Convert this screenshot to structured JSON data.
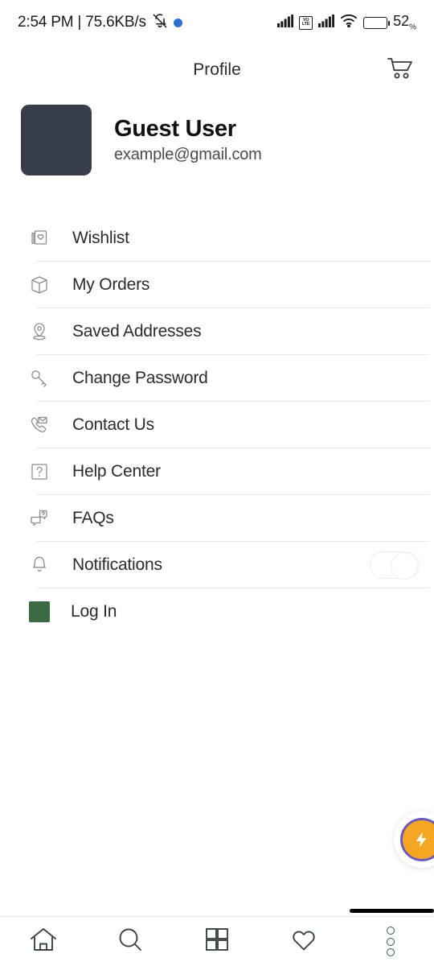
{
  "statusbar": {
    "time_and_speed": "2:54 PM | 75.6KB/s",
    "mute_icon": "bell-muted-icon",
    "dot_icon": "blue-dot-indicator",
    "signal_icon": "signal-bars-icon",
    "volte_line1": "VO",
    "volte_line2": "LTE",
    "signal2_icon": "signal-bars-icon-2",
    "wifi_icon": "wifi-icon",
    "battery_icon": "battery-icon",
    "battery_percent": "52",
    "battery_unit": "%"
  },
  "header": {
    "title": "Profile",
    "cart_icon": "shopping-cart-icon"
  },
  "profile": {
    "name": "Guest User",
    "email": "example@gmail.com",
    "avatar_color": "#373E4A"
  },
  "menu": {
    "items": [
      {
        "label": "Wishlist",
        "icon": "wishlist-page-heart-icon"
      },
      {
        "label": "My Orders",
        "icon": "package-box-icon"
      },
      {
        "label": "Saved Addresses",
        "icon": "location-pin-icon"
      },
      {
        "label": "Change Password",
        "icon": "key-icon"
      },
      {
        "label": "Contact Us",
        "icon": "phone-envelope-icon"
      },
      {
        "label": "Help Center",
        "icon": "question-box-icon"
      },
      {
        "label": "FAQs",
        "icon": "chat-question-icon"
      },
      {
        "label": "Notifications",
        "icon": "bell-icon",
        "toggle": "off"
      },
      {
        "label": "Log In",
        "icon": "login-green-square-icon"
      }
    ]
  },
  "fab": {
    "icon": "assistant-bolt-icon",
    "ring_color": "#6B5BBD",
    "fill_color": "#F5A623"
  },
  "bottomnav": {
    "items": [
      {
        "icon": "home-icon"
      },
      {
        "icon": "search-icon"
      },
      {
        "icon": "grid-categories-icon"
      },
      {
        "icon": "heart-icon"
      },
      {
        "icon": "more-dots-icon"
      }
    ],
    "accent_color": "#32545C"
  }
}
